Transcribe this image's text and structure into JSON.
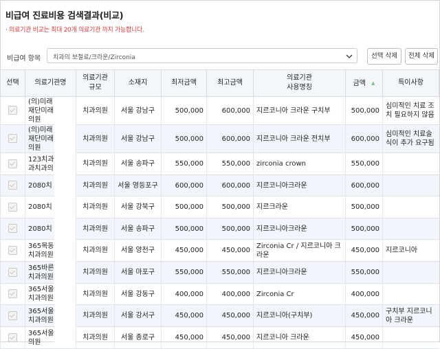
{
  "page": {
    "title": "비급여 진료비용 검색결과(비교)",
    "notice": "· 의료기관 비교는 최대 20개 의료기관 까지 가능합니다."
  },
  "filter": {
    "label": "비급여 항목",
    "selected": "치과의 보철료/크라운/Zirconia",
    "btn_select_delete": "선택 삭제",
    "btn_all_delete": "전체 삭제"
  },
  "table": {
    "headers": {
      "select": "선택",
      "name": "의료기관명",
      "size_1": "의료기관",
      "size_2": "규모",
      "location": "소재지",
      "min": "최저금액",
      "max": "최고금액",
      "usename_1": "의료기관",
      "usename_2": "사용명칭",
      "amount": "금액",
      "note": "특이사항"
    },
    "rows": [
      {
        "name": [
          "(의)미래",
          "재단미래",
          "의원"
        ],
        "size": "치과의원",
        "loc": "서울 강남구",
        "min": "500,000",
        "max": "600,000",
        "usename": "지르코니아 크라운 구치부",
        "amount": "500,000",
        "note": "심미적인 치료 조치 필요하지 않음"
      },
      {
        "name": [
          "(의)미래",
          "재단미래",
          "의원"
        ],
        "size": "치과의원",
        "loc": "서울 강남구",
        "min": "500,000",
        "max": "600,000",
        "usename": "지르코니아 크라운 전치부",
        "amount": "600,000",
        "note": "심미적인 치료술식이 추가 요구됨"
      },
      {
        "name": [
          "123치과",
          "과치과의"
        ],
        "size": "치과의원",
        "loc": "서울 송파구",
        "min": "550,000",
        "max": "550,000",
        "usename": "zirconia crown",
        "amount": "550,000",
        "note": ""
      },
      {
        "name": [
          "2080치"
        ],
        "size": "치과의원",
        "loc": "서울 영등포구",
        "min": "600,000",
        "max": "600,000",
        "usename": "지르코니아크라운",
        "amount": "600,000",
        "note": ""
      },
      {
        "name": [
          "2080치"
        ],
        "size": "치과의원",
        "loc": "서울 강북구",
        "min": "500,000",
        "max": "500,000",
        "usename": "지르크라운",
        "amount": "500,000",
        "note": ""
      },
      {
        "name": [
          "2080치"
        ],
        "size": "치과의원",
        "loc": "서울 송파구",
        "min": "500,000",
        "max": "500,000",
        "usename": "지르코니아크라운",
        "amount": "500,000",
        "note": ""
      },
      {
        "name": [
          "365목동",
          "치과의원"
        ],
        "size": "치과의원",
        "loc": "서울 양천구",
        "min": "450,000",
        "max": "450,000",
        "usename": "Zirconia Cr / 지르코니아 크라운",
        "amount": "450,000",
        "note": "지르코니아"
      },
      {
        "name": [
          "365바른",
          "치과의원"
        ],
        "size": "치과의원",
        "loc": "서울 마포구",
        "min": "550,000",
        "max": "550,000",
        "usename": "지르코니아크라운",
        "amount": "550,000",
        "note": ""
      },
      {
        "name": [
          "365서울",
          "치과의원"
        ],
        "size": "치과의원",
        "loc": "서울 강동구",
        "min": "400,000",
        "max": "400,000",
        "usename": "Zirconia Cr",
        "amount": "400,000",
        "note": ""
      },
      {
        "name": [
          "365서울",
          "치과의원"
        ],
        "size": "치과의원",
        "loc": "서울 강서구",
        "min": "450,000",
        "max": "450,000",
        "usename": "지르코니아(구치부)",
        "amount": "450,000",
        "note": "구치부 지르코니아 크라운"
      },
      {
        "name": [
          "365서울",
          "의원"
        ],
        "size": "치과의원",
        "loc": "서울 종로구",
        "min": "450,000",
        "max": "450,000",
        "usename": "지르코니아 크라운",
        "amount": "450,000",
        "note": ""
      }
    ]
  },
  "colors": {
    "notice": "#d83a3a",
    "header_bg": "#f4f7fa",
    "alt_row_bg": "#f2f5fb",
    "sort_icon": "#7fc37f"
  },
  "icons": {
    "dropdown": "chevron-down-icon",
    "sort": "sort-asc-icon",
    "checkbox": "checkbox-icon"
  }
}
